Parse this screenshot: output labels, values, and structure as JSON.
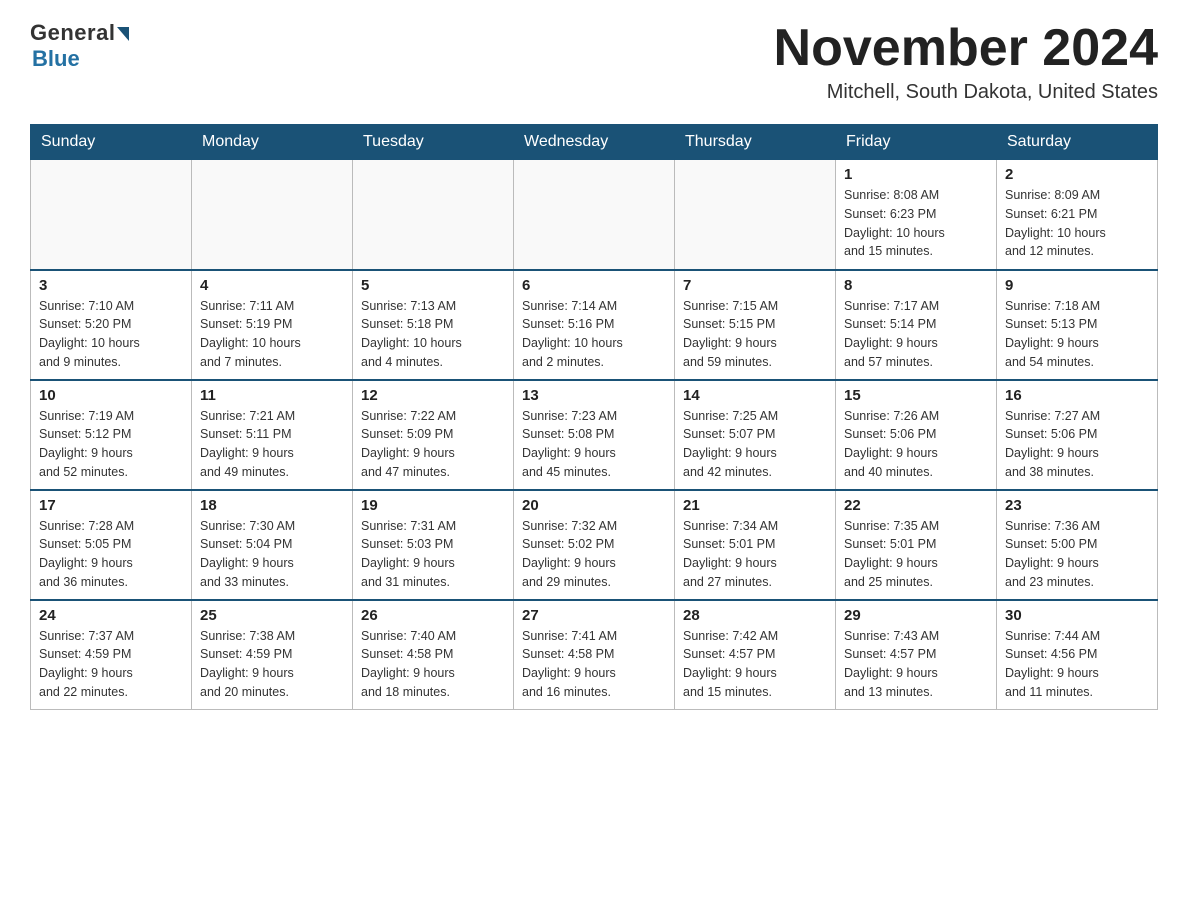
{
  "logo": {
    "general": "General",
    "blue": "Blue",
    "tagline": "Blue"
  },
  "header": {
    "month": "November 2024",
    "location": "Mitchell, South Dakota, United States"
  },
  "weekdays": [
    "Sunday",
    "Monday",
    "Tuesday",
    "Wednesday",
    "Thursday",
    "Friday",
    "Saturday"
  ],
  "weeks": [
    [
      {
        "day": "",
        "info": ""
      },
      {
        "day": "",
        "info": ""
      },
      {
        "day": "",
        "info": ""
      },
      {
        "day": "",
        "info": ""
      },
      {
        "day": "",
        "info": ""
      },
      {
        "day": "1",
        "info": "Sunrise: 8:08 AM\nSunset: 6:23 PM\nDaylight: 10 hours\nand 15 minutes."
      },
      {
        "day": "2",
        "info": "Sunrise: 8:09 AM\nSunset: 6:21 PM\nDaylight: 10 hours\nand 12 minutes."
      }
    ],
    [
      {
        "day": "3",
        "info": "Sunrise: 7:10 AM\nSunset: 5:20 PM\nDaylight: 10 hours\nand 9 minutes."
      },
      {
        "day": "4",
        "info": "Sunrise: 7:11 AM\nSunset: 5:19 PM\nDaylight: 10 hours\nand 7 minutes."
      },
      {
        "day": "5",
        "info": "Sunrise: 7:13 AM\nSunset: 5:18 PM\nDaylight: 10 hours\nand 4 minutes."
      },
      {
        "day": "6",
        "info": "Sunrise: 7:14 AM\nSunset: 5:16 PM\nDaylight: 10 hours\nand 2 minutes."
      },
      {
        "day": "7",
        "info": "Sunrise: 7:15 AM\nSunset: 5:15 PM\nDaylight: 9 hours\nand 59 minutes."
      },
      {
        "day": "8",
        "info": "Sunrise: 7:17 AM\nSunset: 5:14 PM\nDaylight: 9 hours\nand 57 minutes."
      },
      {
        "day": "9",
        "info": "Sunrise: 7:18 AM\nSunset: 5:13 PM\nDaylight: 9 hours\nand 54 minutes."
      }
    ],
    [
      {
        "day": "10",
        "info": "Sunrise: 7:19 AM\nSunset: 5:12 PM\nDaylight: 9 hours\nand 52 minutes."
      },
      {
        "day": "11",
        "info": "Sunrise: 7:21 AM\nSunset: 5:11 PM\nDaylight: 9 hours\nand 49 minutes."
      },
      {
        "day": "12",
        "info": "Sunrise: 7:22 AM\nSunset: 5:09 PM\nDaylight: 9 hours\nand 47 minutes."
      },
      {
        "day": "13",
        "info": "Sunrise: 7:23 AM\nSunset: 5:08 PM\nDaylight: 9 hours\nand 45 minutes."
      },
      {
        "day": "14",
        "info": "Sunrise: 7:25 AM\nSunset: 5:07 PM\nDaylight: 9 hours\nand 42 minutes."
      },
      {
        "day": "15",
        "info": "Sunrise: 7:26 AM\nSunset: 5:06 PM\nDaylight: 9 hours\nand 40 minutes."
      },
      {
        "day": "16",
        "info": "Sunrise: 7:27 AM\nSunset: 5:06 PM\nDaylight: 9 hours\nand 38 minutes."
      }
    ],
    [
      {
        "day": "17",
        "info": "Sunrise: 7:28 AM\nSunset: 5:05 PM\nDaylight: 9 hours\nand 36 minutes."
      },
      {
        "day": "18",
        "info": "Sunrise: 7:30 AM\nSunset: 5:04 PM\nDaylight: 9 hours\nand 33 minutes."
      },
      {
        "day": "19",
        "info": "Sunrise: 7:31 AM\nSunset: 5:03 PM\nDaylight: 9 hours\nand 31 minutes."
      },
      {
        "day": "20",
        "info": "Sunrise: 7:32 AM\nSunset: 5:02 PM\nDaylight: 9 hours\nand 29 minutes."
      },
      {
        "day": "21",
        "info": "Sunrise: 7:34 AM\nSunset: 5:01 PM\nDaylight: 9 hours\nand 27 minutes."
      },
      {
        "day": "22",
        "info": "Sunrise: 7:35 AM\nSunset: 5:01 PM\nDaylight: 9 hours\nand 25 minutes."
      },
      {
        "day": "23",
        "info": "Sunrise: 7:36 AM\nSunset: 5:00 PM\nDaylight: 9 hours\nand 23 minutes."
      }
    ],
    [
      {
        "day": "24",
        "info": "Sunrise: 7:37 AM\nSunset: 4:59 PM\nDaylight: 9 hours\nand 22 minutes."
      },
      {
        "day": "25",
        "info": "Sunrise: 7:38 AM\nSunset: 4:59 PM\nDaylight: 9 hours\nand 20 minutes."
      },
      {
        "day": "26",
        "info": "Sunrise: 7:40 AM\nSunset: 4:58 PM\nDaylight: 9 hours\nand 18 minutes."
      },
      {
        "day": "27",
        "info": "Sunrise: 7:41 AM\nSunset: 4:58 PM\nDaylight: 9 hours\nand 16 minutes."
      },
      {
        "day": "28",
        "info": "Sunrise: 7:42 AM\nSunset: 4:57 PM\nDaylight: 9 hours\nand 15 minutes."
      },
      {
        "day": "29",
        "info": "Sunrise: 7:43 AM\nSunset: 4:57 PM\nDaylight: 9 hours\nand 13 minutes."
      },
      {
        "day": "30",
        "info": "Sunrise: 7:44 AM\nSunset: 4:56 PM\nDaylight: 9 hours\nand 11 minutes."
      }
    ]
  ]
}
